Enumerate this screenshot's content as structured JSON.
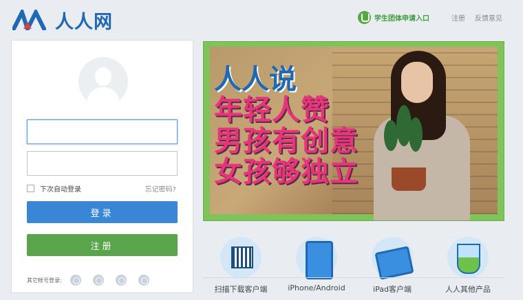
{
  "header": {
    "logo_text": "人人网",
    "student_entry": "学生团体申请入口",
    "register_link": "注册",
    "feedback_link": "反馈意见"
  },
  "login": {
    "username_value": "",
    "password_value": "",
    "remember_label": "下次自动登录",
    "forgot_label": "忘记密码?",
    "login_button": "登录",
    "register_button": "注册",
    "other_accounts_label": "其它帐号登录:",
    "other_account_icons": [
      "mobile-network-icon",
      "sina-icon",
      "upload-icon",
      "paw-icon"
    ]
  },
  "banner": {
    "brand": "人人说",
    "line1": "年轻人赞",
    "line2": "男孩有创意",
    "line3": "女孩够独立"
  },
  "clients": [
    {
      "label": "扫描下载客户端",
      "icon": "qr-code-icon"
    },
    {
      "label": "iPhone/Android",
      "icon": "phone-icon"
    },
    {
      "label": "iPad客户端",
      "icon": "tablet-icon"
    },
    {
      "label": "人人其他产品",
      "icon": "flask-icon"
    }
  ],
  "colors": {
    "brand_blue": "#1f69b4",
    "login_button": "#3a86d6",
    "register_button": "#5aa54b",
    "banner_border": "#7fc35a"
  }
}
